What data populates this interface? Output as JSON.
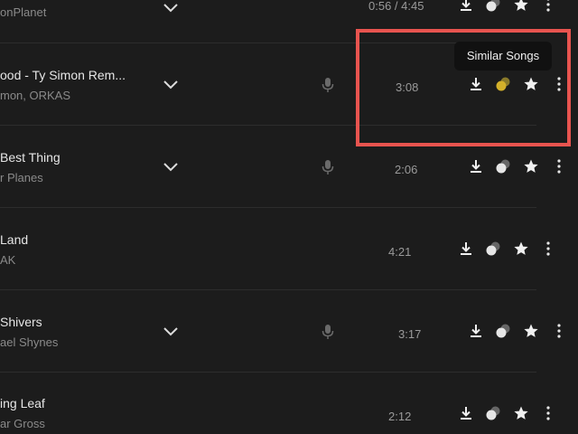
{
  "tooltip": {
    "text": "Similar Songs"
  },
  "icons": {
    "download": "download-icon",
    "similar": "similar-songs-icon",
    "favorite": "star-icon",
    "more": "more-options-icon",
    "expand": "chevron-down-icon",
    "vocals": "microphone-icon"
  },
  "colors": {
    "highlight": "#e8544f",
    "similar_active": "#d4b12a",
    "background": "#1c1c1c"
  },
  "tracks": [
    {
      "title": "",
      "artist": "onPlanet",
      "duration": "0:56 / 4:45"
    },
    {
      "title": "ood - Ty Simon Rem...",
      "artist": "mon, ORKAS",
      "duration": "3:08"
    },
    {
      "title": "Best Thing",
      "artist": "r Planes",
      "duration": "2:06"
    },
    {
      "title": "Land",
      "artist": "AK",
      "duration": "4:21"
    },
    {
      "title": "Shivers",
      "artist": "ael Shynes",
      "duration": "3:17"
    },
    {
      "title": "ing Leaf",
      "artist": "ar Gross",
      "duration": "2:12"
    }
  ]
}
